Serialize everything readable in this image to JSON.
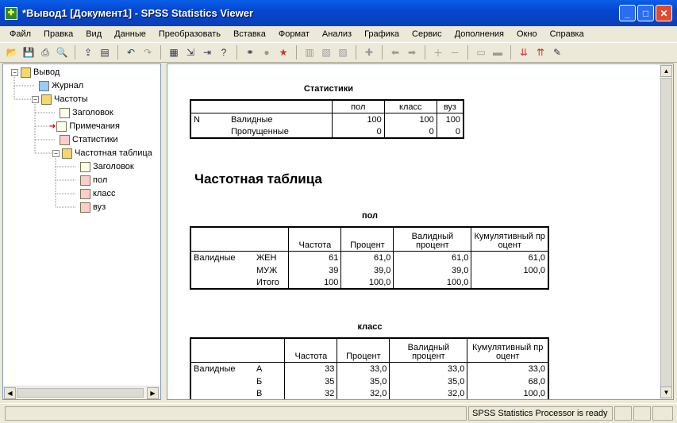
{
  "window": {
    "title": "*Вывод1 [Документ1] - SPSS Statistics Viewer"
  },
  "menu": [
    "Файл",
    "Правка",
    "Вид",
    "Данные",
    "Преобразовать",
    "Вставка",
    "Формат",
    "Анализ",
    "Графика",
    "Сервис",
    "Дополнения",
    "Окно",
    "Справка"
  ],
  "tree": {
    "root": "Вывод",
    "journal": "Журнал",
    "freq": "Частоты",
    "freq_title": "Заголовок",
    "notes": "Примечания",
    "stats": "Статистики",
    "freq_table": "Частотная таблица",
    "ft_title": "Заголовок",
    "ft_pol": "пол",
    "ft_klass": "класс",
    "ft_vuz": "вуз"
  },
  "stats_table": {
    "caption": "Статистики",
    "cols": [
      "пол",
      "класс",
      "вуз"
    ],
    "n": "N",
    "valid_label": "Валидные",
    "missing_label": "Пропущенные",
    "valid": [
      "100",
      "100",
      "100"
    ],
    "missing": [
      "0",
      "0",
      "0"
    ]
  },
  "heading": "Частотная таблица",
  "freq_headers": {
    "freq": "Частота",
    "pct": "Процент",
    "valid_pct": "Валидный процент",
    "cum_pct": "Кумулятивный процент"
  },
  "pol_table": {
    "caption": "пол",
    "group": "Валидные",
    "rows": [
      {
        "label": "ЖЕН",
        "freq": "61",
        "pct": "61,0",
        "vpct": "61,0",
        "cpct": "61,0"
      },
      {
        "label": "МУЖ",
        "freq": "39",
        "pct": "39,0",
        "vpct": "39,0",
        "cpct": "100,0"
      },
      {
        "label": "Итого",
        "freq": "100",
        "pct": "100,0",
        "vpct": "100,0",
        "cpct": ""
      }
    ]
  },
  "klass_table": {
    "caption": "класс",
    "group": "Валидные",
    "rows": [
      {
        "label": "А",
        "freq": "33",
        "pct": "33,0",
        "vpct": "33,0",
        "cpct": "33,0"
      },
      {
        "label": "Б",
        "freq": "35",
        "pct": "35,0",
        "vpct": "35,0",
        "cpct": "68,0"
      },
      {
        "label": "В",
        "freq": "32",
        "pct": "32,0",
        "vpct": "32,0",
        "cpct": "100,0"
      }
    ]
  },
  "status": {
    "processor": "SPSS Statistics  Processor is ready"
  }
}
